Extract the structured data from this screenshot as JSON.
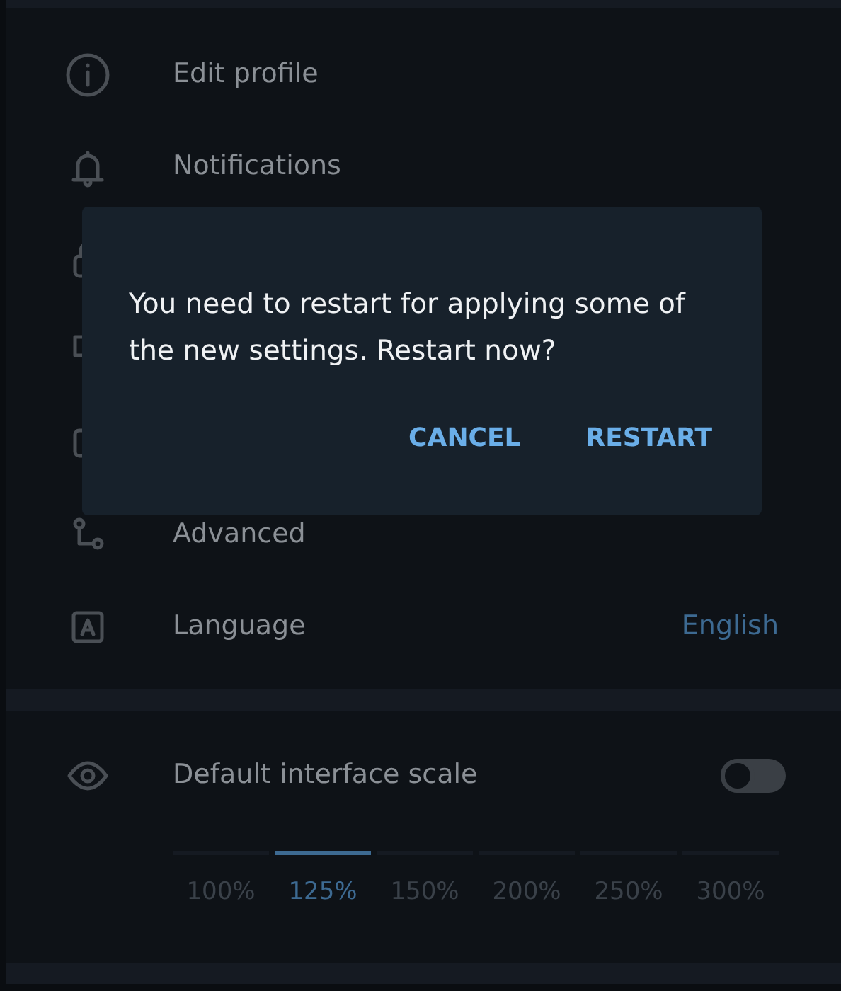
{
  "settings_menu": [
    {
      "kind": "item",
      "label": "Edit profile"
    },
    {
      "kind": "item",
      "label": "Notifications"
    },
    {
      "kind": "covered"
    },
    {
      "kind": "covered"
    },
    {
      "kind": "covered"
    },
    {
      "kind": "item",
      "label": "Advanced"
    },
    {
      "kind": "item",
      "label": "Language",
      "value": "English"
    }
  ],
  "scale": {
    "label": "Default interface scale",
    "on": false,
    "steps": [
      {
        "label": "100%",
        "selected": false
      },
      {
        "label": "125%",
        "selected": true
      },
      {
        "label": "150%",
        "selected": false
      },
      {
        "label": "200%",
        "selected": false
      },
      {
        "label": "250%",
        "selected": false
      },
      {
        "label": "300%",
        "selected": false
      }
    ]
  },
  "dialog": {
    "message": "You need to restart for applying some of the new settings. Restart now?",
    "buttons": [
      "CANCEL",
      "RESTART"
    ]
  }
}
